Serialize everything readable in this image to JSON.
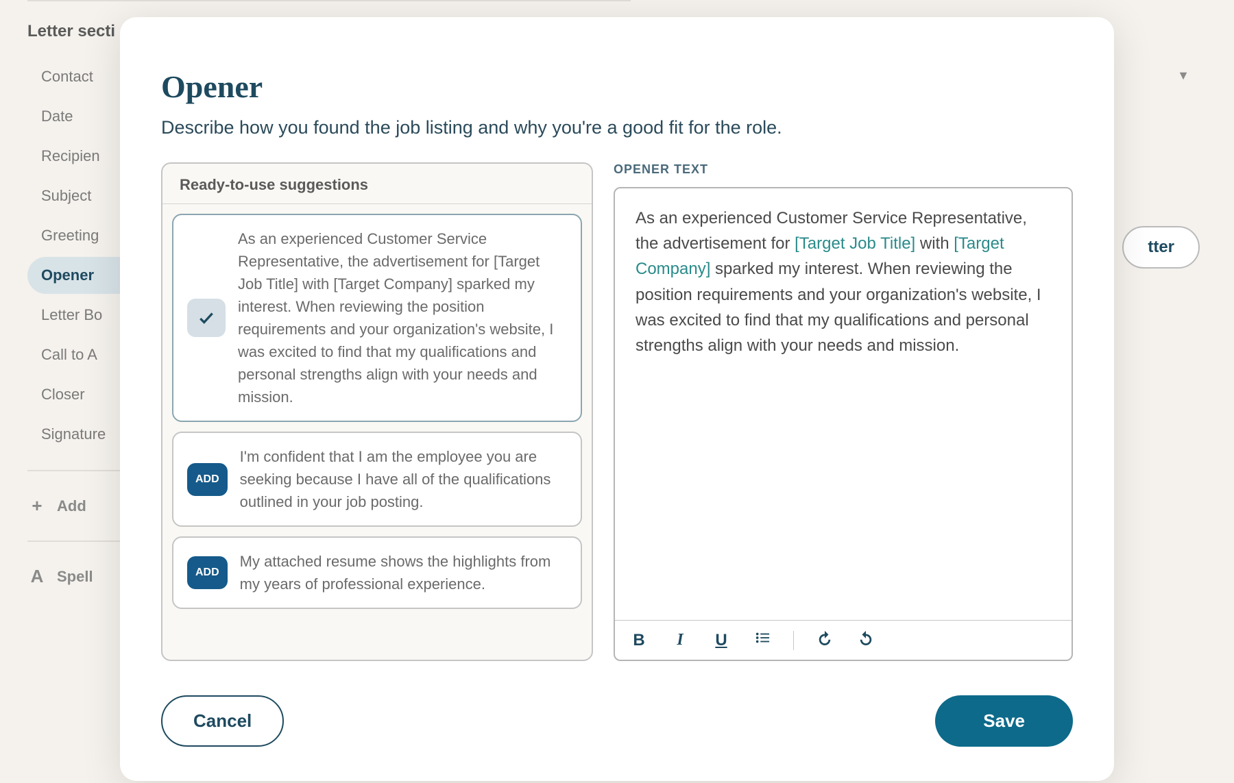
{
  "sidebar": {
    "heading": "Letter secti",
    "items": [
      {
        "label": "Contact"
      },
      {
        "label": "Date"
      },
      {
        "label": "Recipien"
      },
      {
        "label": "Subject"
      },
      {
        "label": "Greeting"
      },
      {
        "label": "Opener"
      },
      {
        "label": "Letter Bo"
      },
      {
        "label": "Call to A"
      },
      {
        "label": "Closer"
      },
      {
        "label": "Signature"
      }
    ],
    "add_label": "Add",
    "spell_label": "Spell"
  },
  "right_button_text": "tter",
  "modal": {
    "title": "Opener",
    "subtitle": "Describe how you found the job listing and why you're a good fit for the role.",
    "suggestions_header": "Ready-to-use suggestions",
    "suggestions": [
      {
        "selected": true,
        "text": "As an experienced Customer Service Representative, the advertisement for [Target Job Title] with [Target Company] sparked my interest. When reviewing the position requirements and your organization's website, I was excited to find that my qualifications and personal strengths align with your needs and mission."
      },
      {
        "selected": false,
        "button": "ADD",
        "text": "I'm confident that I am the employee you are seeking because I have all of the qualifications outlined in your job posting."
      },
      {
        "selected": false,
        "button": "ADD",
        "text": "My attached resume shows the highlights from my years of professional experience."
      }
    ],
    "editor_label": "OPENER TEXT",
    "editor_text": {
      "p1": "As an experienced Customer Service Representative, the advertisement for ",
      "ph1": "[Target Job Title]",
      "p2": " with ",
      "ph2": "[Target Company]",
      "p3": " sparked my interest. When reviewing the position requirements and your organization's website, I was excited to find that my qualifications and personal strengths align with your needs and mission."
    },
    "cancel": "Cancel",
    "save": "Save"
  }
}
